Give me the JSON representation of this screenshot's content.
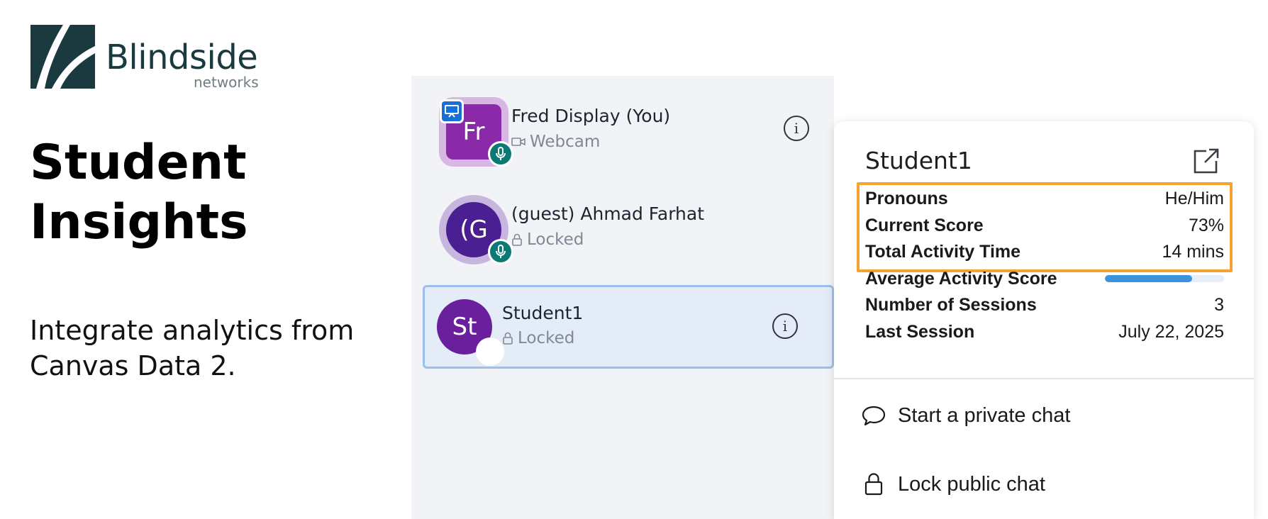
{
  "brand": {
    "name": "Blindside",
    "subname": "networks",
    "mark_color": "#1b3a3f"
  },
  "hero": {
    "title_line1": "Student",
    "title_line2": "Insights",
    "subtitle_line1": "Integrate analytics from",
    "subtitle_line2": "Canvas Data 2."
  },
  "users": [
    {
      "avatar": "Fr",
      "name": "Fred Display (You)",
      "status": "Webcam",
      "status_icon": "webcam-icon",
      "presenter": true,
      "mic": true
    },
    {
      "avatar": "(G",
      "name": "(guest) Ahmad Farhat",
      "status": "Locked",
      "status_icon": "lock-icon",
      "presenter": false,
      "mic": true
    },
    {
      "avatar": "St",
      "name": "Student1",
      "status": "Locked",
      "status_icon": "lock-icon",
      "presenter": false,
      "mic": false,
      "selected": true
    }
  ],
  "card": {
    "title": "Student1",
    "stats": {
      "pronouns_label": "Pronouns",
      "pronouns_value": "He/Him",
      "score_label": "Current Score",
      "score_value": "73%",
      "time_label": "Total Activity Time",
      "time_value": "14 mins",
      "avg_label": "Average Activity Score",
      "avg_fraction": 0.73,
      "sessions_label": "Number of Sessions",
      "sessions_value": "3",
      "last_label": "Last Session",
      "last_value": "July 22, 2025"
    },
    "actions": {
      "private_chat": "Start a private chat",
      "lock_chat": "Lock public chat"
    }
  },
  "colors": {
    "highlight": "#f5a233",
    "accent": "#3a93dc",
    "selected_border": "#9cc0ec"
  }
}
